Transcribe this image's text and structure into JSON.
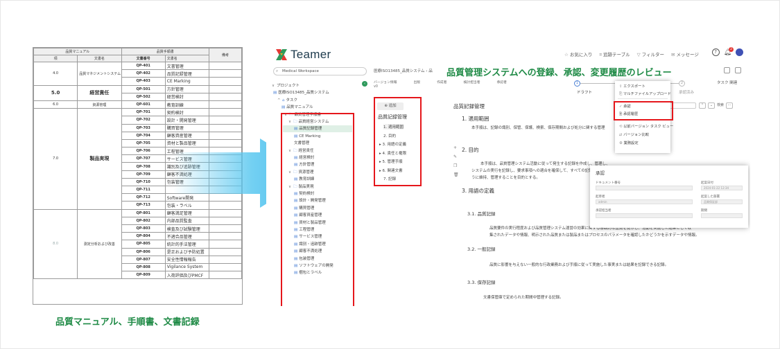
{
  "document": {
    "header_left": "品質マニュアル",
    "header_right": "品質手順書",
    "col_section": "項",
    "col_docname": "文書名",
    "col_docno": "文書番号",
    "col_docname2": "文書名",
    "col_note": "備考",
    "sections": [
      {
        "num": "4.0",
        "name": "品質マネジメントシステム",
        "rows": [
          {
            "code": "QP-401",
            "title": "文書管理"
          },
          {
            "code": "QP-402",
            "title": "品質記録管理"
          },
          {
            "code": "QP-403",
            "title": "CE Marking"
          }
        ]
      },
      {
        "num": "5.0",
        "name": "経営責任",
        "rows": [
          {
            "code": "QP-501",
            "title": "方針管理"
          },
          {
            "code": "QP-502",
            "title": "経営検討"
          }
        ]
      },
      {
        "num": "6.0",
        "name": "資源管理",
        "rows": [
          {
            "code": "QP-601",
            "title": "教育訓練"
          }
        ]
      },
      {
        "num": "7.0",
        "name": "製品実現",
        "rows": [
          {
            "code": "QP-701",
            "title": "契約検討"
          },
          {
            "code": "QP-702",
            "title": "設計・開発管理"
          },
          {
            "code": "QP-703",
            "title": "購買管理"
          },
          {
            "code": "QP-704",
            "title": "顧客資産管理"
          },
          {
            "code": "QP-705",
            "title": "資材と製品管理"
          },
          {
            "code": "QP-706",
            "title": "工程管理"
          },
          {
            "code": "QP-707",
            "title": "サービス管理"
          },
          {
            "code": "QP-708",
            "title": "識別及び追跡管理"
          },
          {
            "code": "QP-709",
            "title": "顧客不満処理"
          },
          {
            "code": "QP-710",
            "title": "包装管理"
          },
          {
            "code": "QP-711",
            "title": ""
          },
          {
            "code": "QP-712",
            "title": "Software開発"
          },
          {
            "code": "QP-713",
            "title": "包装・ラベル"
          }
        ]
      },
      {
        "num": "8.0",
        "name": "測定分析および改善",
        "rows": [
          {
            "code": "QP-801",
            "title": "顧客満足管理"
          },
          {
            "code": "QP-802",
            "title": "内部品質監査"
          },
          {
            "code": "QP-803",
            "title": "検査及び試験管理"
          },
          {
            "code": "QP-804",
            "title": "不適合品管理"
          },
          {
            "code": "QP-805",
            "title": "統計的手法管理"
          },
          {
            "code": "QP-806",
            "title": "是正および予防処置"
          },
          {
            "code": "QP-807",
            "title": "安全性情報報告"
          },
          {
            "code": "QP-808",
            "title": "Vigilance System"
          },
          {
            "code": "QP-809",
            "title": "入荷評価及びPMCF"
          }
        ]
      }
    ]
  },
  "caption_left": "品質マニュアル、手順書、文書記録",
  "headline": "品質管理システムへの登録、承認、変更履歴のレビュー",
  "app": {
    "logo": "Teamer",
    "topnav": [
      {
        "icon": "☆",
        "label": "お気に入り"
      },
      {
        "icon": "⌗",
        "label": "追跡テーブル"
      },
      {
        "icon": "▽",
        "label": "フィルター"
      },
      {
        "icon": "✉",
        "label": "メッセージ"
      }
    ],
    "notification_count": "2",
    "workspace": "Medical Workspace",
    "sidebar": {
      "project_label": "プロジェクト",
      "project": "医療ISO13485_品質システム",
      "task": "タスク",
      "manual": "品質マニュアル",
      "procedures": "品質管理手順書",
      "folders": [
        {
          "label": "品質経営システム",
          "items": [
            "品質記録管理",
            "CE Marking",
            "文書管理"
          ]
        },
        {
          "label": "経営責任",
          "items": [
            "経営検討",
            "方針管理"
          ]
        },
        {
          "label": "資源管理",
          "items": [
            "教育訓練"
          ]
        },
        {
          "label": "製品実現",
          "items": [
            "契約検討",
            "設計・開発管理",
            "購買管理",
            "顧客資産管理",
            "資材と製品管理",
            "工程管理",
            "サービス管理",
            "識別・追跡管理",
            "顧客不満処理",
            "包装管理",
            "ソフトウェアの開発",
            "梱包とラベル"
          ]
        }
      ]
    },
    "breadcrumb": "医療ISO13485_品質システム  ›  品",
    "meta_labels": [
      "バージョン情報",
      "出版",
      "作成者",
      "検討担当者",
      "承認者"
    ],
    "version": "v0",
    "steps": {
      "one": "1",
      "two": "2",
      "draft": "ドラフト",
      "approved": "承認済み"
    },
    "task_button": "タスク 関連",
    "add_button": "追加",
    "toc_title": "品質記録管理",
    "toc": [
      "1. 適用範囲",
      "2. 目的",
      "3. 用語の定義",
      "4. 責任と権限",
      "5. 管理手順",
      "6. 関連文書",
      "7. 記録"
    ],
    "doc_title": "品質記録管理",
    "content": {
      "h1": "1. 適用範囲",
      "p1": "本手順は、記録の識別、保管、保護、検索、保存期間および処分に関する管理",
      "h2": "2. 目的",
      "p2a": "本手順は、品質管理システム活動に従って発生する記録を作成し、管理し、",
      "p2b": "システムの実行を記録し、要求事項への適合を確保して、すべての記録",
      "p2c": "うに維持、管理することを目的とする。",
      "h3": "3. 用語の定義",
      "h31": "3.1. 品質記録",
      "p31a": "品質要件の実行程度および品質管理システム運営の効果に関する客観的な証拠を提示し、活動を実施した結果として収",
      "p31b": "集されたデータや情報、明示された品質または製品またはプロセスのパラメータを確認したかどうかを示すデータや情報。",
      "h32": "3.2. 一般記録",
      "p32": "品質に影響を与えない一般的な行政業務および手順に従って実施した事実または結果を記録できる記録。",
      "h33": "3.3. 保存記録",
      "p33": "文書保管庫で定められた期間中管理する記録。"
    },
    "search_label": "検索",
    "menu": [
      "エクスポート",
      "マルチファイルアップロード",
      "承認",
      "承認履歴",
      "以前バージョン タスク ビュー",
      "バージョン比較",
      "業務設定"
    ],
    "dialog": {
      "title": "承認",
      "fields": [
        "ドキュメント番号",
        "起案日付",
        "起草者",
        "起案した部署",
        "承認担当者",
        "期間"
      ],
      "values": [
        "",
        "2024-01-22 12:34",
        "admin",
        "品質保証部",
        "",
        ""
      ]
    }
  },
  "colors": {
    "accent_green": "#1e8a45",
    "highlight_red": "#e5161b",
    "arrow_blue": "#5bc8f0"
  }
}
